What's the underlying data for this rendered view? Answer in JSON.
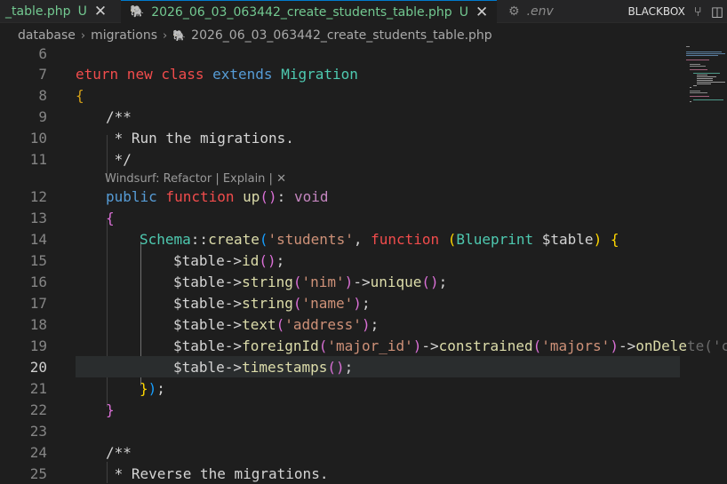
{
  "tabs": [
    {
      "label": "_table.php",
      "status": "U",
      "active": false
    },
    {
      "label": "2026_06_03_063442_create_students_table.php",
      "status": "U",
      "active": true
    },
    {
      "label": ".env",
      "active": false
    }
  ],
  "title_right": {
    "label": "BLACKBOX"
  },
  "breadcrumb": {
    "items": [
      "database",
      "migrations",
      "2026_06_03_063442_create_students_table.php"
    ]
  },
  "codelens": {
    "text": "Windsurf: Refactor | Explain | ✕"
  },
  "lines": [
    {
      "n": "6"
    },
    {
      "n": "7"
    },
    {
      "n": "8"
    },
    {
      "n": "9"
    },
    {
      "n": "10"
    },
    {
      "n": "11"
    },
    {
      "n": "12"
    },
    {
      "n": "13"
    },
    {
      "n": "14"
    },
    {
      "n": "15"
    },
    {
      "n": "16"
    },
    {
      "n": "17"
    },
    {
      "n": "18"
    },
    {
      "n": "19"
    },
    {
      "n": "20"
    },
    {
      "n": "21"
    },
    {
      "n": "22"
    },
    {
      "n": "23"
    },
    {
      "n": "24"
    },
    {
      "n": "25"
    }
  ],
  "code": {
    "l7": {
      "a": "eturn",
      "b": " new",
      "c": " class",
      "d": " extends",
      "e": " Migration"
    },
    "l8": {
      "a": "{"
    },
    "l9": {
      "a": "/**"
    },
    "l10": {
      "a": " * Run the migrations."
    },
    "l11": {
      "a": " */"
    },
    "l12": {
      "a": "public",
      "b": " function",
      "c": " up",
      "d": "()",
      "e": ": ",
      "f": "void"
    },
    "l13": {
      "a": "{"
    },
    "l14": {
      "a": "Schema",
      "b": "::",
      "c": "create",
      "d": "(",
      "e": "'students'",
      "f": ", ",
      "g": "function",
      "h": " (",
      "i": "Blueprint",
      "j": " $table",
      "k": ")",
      "l": " {"
    },
    "l15": {
      "a": "$table",
      "b": "->",
      "c": "id",
      "d": "()",
      "e": ";"
    },
    "l16": {
      "a": "$table",
      "b": "->",
      "c": "string",
      "d": "(",
      "e": "'nim'",
      "f": ")",
      "g": "->",
      "h": "unique",
      "i": "()",
      "j": ";"
    },
    "l17": {
      "a": "$table",
      "b": "->",
      "c": "string",
      "d": "(",
      "e": "'name'",
      "f": ")",
      "g": ";"
    },
    "l18": {
      "a": "$table",
      "b": "->",
      "c": "text",
      "d": "(",
      "e": "'address'",
      "f": ")",
      "g": ";"
    },
    "l19": {
      "a": "$table",
      "b": "->",
      "c": "foreignId",
      "d": "(",
      "e": "'major_id'",
      "f": ")",
      "g": "->",
      "h": "constrained",
      "i": "(",
      "j": "'majors'",
      "k": ")",
      "l": "->",
      "m": "onDele",
      "n": "te('c"
    },
    "l20": {
      "a": "$table",
      "b": "->",
      "c": "timestamps",
      "d": "()",
      "e": ";"
    },
    "l21": {
      "a": "}",
      "b": ")",
      "c": ";"
    },
    "l22": {
      "a": "}"
    },
    "l24": {
      "a": "/**"
    },
    "l25": {
      "a": " * Reverse the migrations."
    }
  },
  "colors": {
    "accent": "#007acc",
    "untracked": "#73c991",
    "background": "#1e1e1e"
  }
}
